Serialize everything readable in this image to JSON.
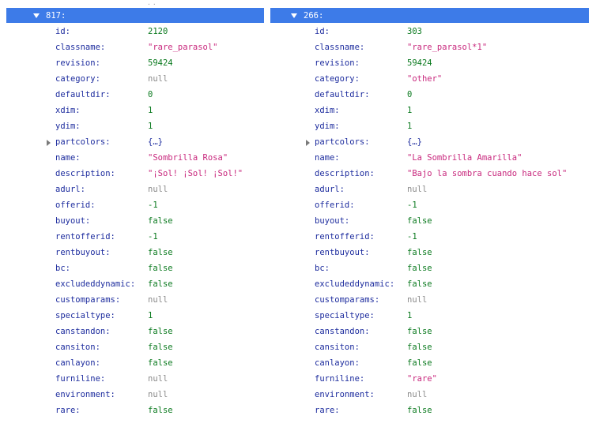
{
  "panels": [
    {
      "key": "817:",
      "rows": [
        {
          "k": "id:",
          "v": "2120",
          "t": "num"
        },
        {
          "k": "classname:",
          "v": "\"rare_parasol\"",
          "t": "str"
        },
        {
          "k": "revision:",
          "v": "59424",
          "t": "num"
        },
        {
          "k": "category:",
          "v": "null",
          "t": "null"
        },
        {
          "k": "defaultdir:",
          "v": "0",
          "t": "num"
        },
        {
          "k": "xdim:",
          "v": "1",
          "t": "num"
        },
        {
          "k": "ydim:",
          "v": "1",
          "t": "num"
        },
        {
          "k": "partcolors:",
          "v": "{…}",
          "t": "obj",
          "expandable": true
        },
        {
          "k": "name:",
          "v": "\"Sombrilla Rosa\"",
          "t": "str"
        },
        {
          "k": "description:",
          "v": "\"¡Sol! ¡Sol! ¡Sol!\"",
          "t": "str"
        },
        {
          "k": "adurl:",
          "v": "null",
          "t": "null"
        },
        {
          "k": "offerid:",
          "v": "-1",
          "t": "num"
        },
        {
          "k": "buyout:",
          "v": "false",
          "t": "bool"
        },
        {
          "k": "rentofferid:",
          "v": "-1",
          "t": "num"
        },
        {
          "k": "rentbuyout:",
          "v": "false",
          "t": "bool"
        },
        {
          "k": "bc:",
          "v": "false",
          "t": "bool"
        },
        {
          "k": "excludeddynamic:",
          "v": "false",
          "t": "bool"
        },
        {
          "k": "customparams:",
          "v": "null",
          "t": "null"
        },
        {
          "k": "specialtype:",
          "v": "1",
          "t": "num"
        },
        {
          "k": "canstandon:",
          "v": "false",
          "t": "bool"
        },
        {
          "k": "cansiton:",
          "v": "false",
          "t": "bool"
        },
        {
          "k": "canlayon:",
          "v": "false",
          "t": "bool"
        },
        {
          "k": "furniline:",
          "v": "null",
          "t": "null"
        },
        {
          "k": "environment:",
          "v": "null",
          "t": "null"
        },
        {
          "k": "rare:",
          "v": "false",
          "t": "bool"
        }
      ]
    },
    {
      "key": "266:",
      "rows": [
        {
          "k": "id:",
          "v": "303",
          "t": "num"
        },
        {
          "k": "classname:",
          "v": "\"rare_parasol*1\"",
          "t": "str"
        },
        {
          "k": "revision:",
          "v": "59424",
          "t": "num"
        },
        {
          "k": "category:",
          "v": "\"other\"",
          "t": "str"
        },
        {
          "k": "defaultdir:",
          "v": "0",
          "t": "num"
        },
        {
          "k": "xdim:",
          "v": "1",
          "t": "num"
        },
        {
          "k": "ydim:",
          "v": "1",
          "t": "num"
        },
        {
          "k": "partcolors:",
          "v": "{…}",
          "t": "obj",
          "expandable": true
        },
        {
          "k": "name:",
          "v": "\"La Sombrilla Amarilla\"",
          "t": "str"
        },
        {
          "k": "description:",
          "v": "\"Bajo la sombra cuando hace sol\"",
          "t": "str"
        },
        {
          "k": "adurl:",
          "v": "null",
          "t": "null"
        },
        {
          "k": "offerid:",
          "v": "-1",
          "t": "num"
        },
        {
          "k": "buyout:",
          "v": "false",
          "t": "bool"
        },
        {
          "k": "rentofferid:",
          "v": "-1",
          "t": "num"
        },
        {
          "k": "rentbuyout:",
          "v": "false",
          "t": "bool"
        },
        {
          "k": "bc:",
          "v": "false",
          "t": "bool"
        },
        {
          "k": "excludeddynamic:",
          "v": "false",
          "t": "bool"
        },
        {
          "k": "customparams:",
          "v": "null",
          "t": "null"
        },
        {
          "k": "specialtype:",
          "v": "1",
          "t": "num"
        },
        {
          "k": "canstandon:",
          "v": "false",
          "t": "bool"
        },
        {
          "k": "cansiton:",
          "v": "false",
          "t": "bool"
        },
        {
          "k": "canlayon:",
          "v": "false",
          "t": "bool"
        },
        {
          "k": "furniline:",
          "v": "\"rare\"",
          "t": "str"
        },
        {
          "k": "environment:",
          "v": "null",
          "t": "null"
        },
        {
          "k": "rare:",
          "v": "false",
          "t": "bool"
        }
      ]
    }
  ],
  "colors": {
    "header_bg": "#3d7be8",
    "key": "#1d2c9e",
    "number": "#0b7a1f",
    "string": "#c8287d",
    "null": "#8a8a8a"
  },
  "icons": {
    "header_toggle": "caret-down-icon",
    "row_expander": "caret-right-icon"
  }
}
